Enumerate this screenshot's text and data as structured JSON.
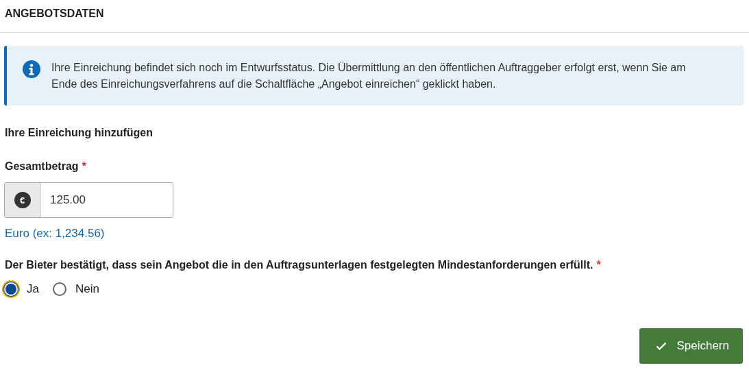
{
  "section_title": "ANGEBOTSDATEN",
  "info": {
    "text": "Ihre Einreichung befindet sich noch im Entwurfsstatus. Die Übermittlung an den öffentlichen Auftraggeber erfolgt erst, wenn Sie am Ende des Einreichungsverfahrens auf die Schaltfläche „Angebot einreichen“ geklickt haben."
  },
  "subheading": "Ihre Einreichung hinzufügen",
  "amount_field": {
    "label": "Gesamtbetrag",
    "required_mark": "*",
    "currency_symbol": "€",
    "value": "125.00",
    "hint": "Euro (ex: 1,234.56)"
  },
  "question": {
    "label": "Der Bieter bestätigt, dass sein Angebot die in den Auftragsunterlagen festgelegten Mindestanforderungen erfüllt.",
    "required_mark": "*",
    "options": [
      {
        "label": "Ja",
        "selected": true,
        "focused": true
      },
      {
        "label": "Nein",
        "selected": false,
        "focused": false
      }
    ]
  },
  "save_button": {
    "label": "Speichern"
  }
}
